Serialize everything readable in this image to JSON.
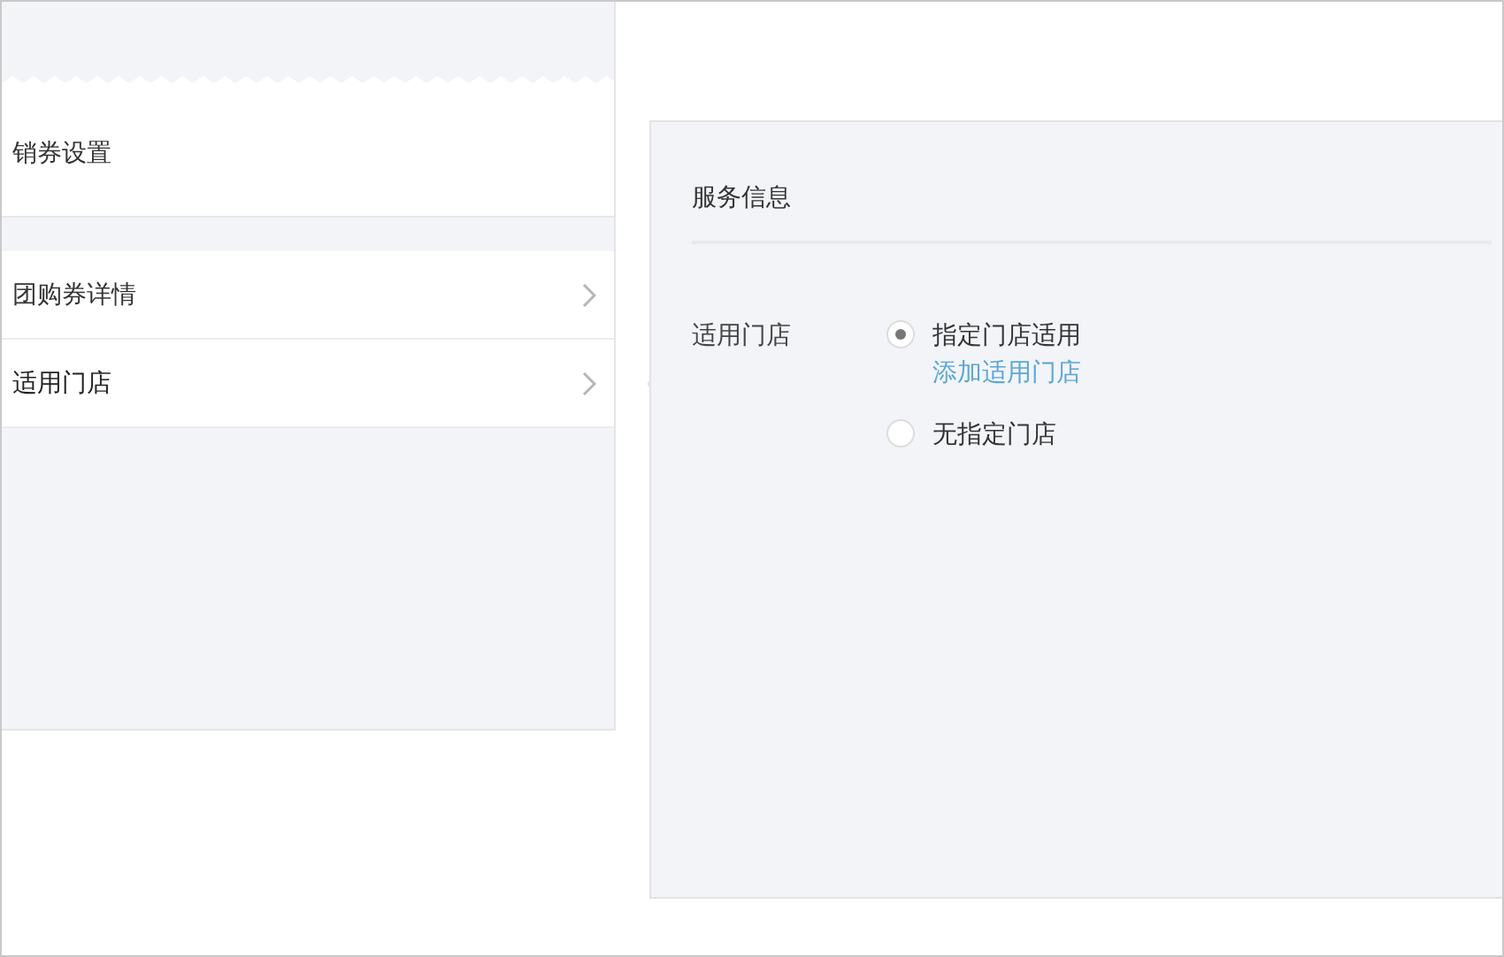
{
  "sidebar": {
    "section_title": "销券设置",
    "items": [
      {
        "label": "团购券详情",
        "selected": false
      },
      {
        "label": "适用门店",
        "selected": true
      }
    ]
  },
  "panel": {
    "title": "服务信息",
    "field": {
      "label": "适用门店",
      "options": [
        {
          "label": "指定门店适用",
          "selected": true,
          "link": "添加适用门店"
        },
        {
          "label": "无指定门店",
          "selected": false
        }
      ]
    }
  }
}
